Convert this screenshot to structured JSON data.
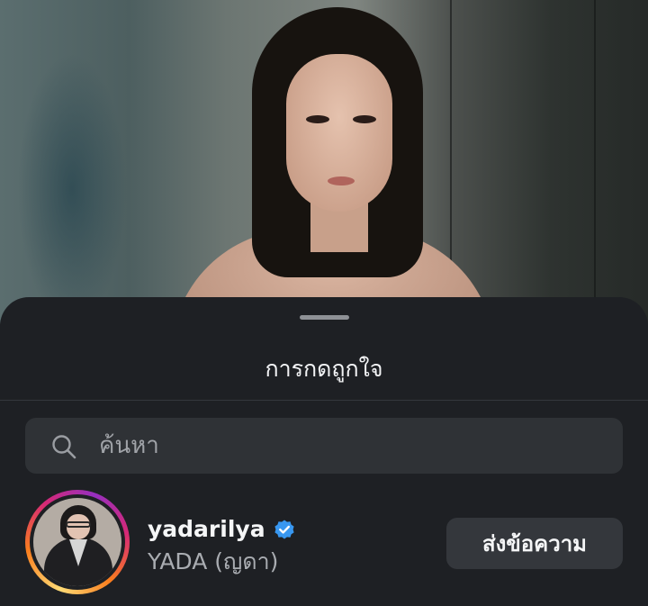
{
  "sheet": {
    "title": "การกดถูกใจ"
  },
  "search": {
    "icon": "search-icon",
    "placeholder": "ค้นหา",
    "value": ""
  },
  "likers": [
    {
      "username": "yadarilya",
      "verified": true,
      "verified_icon": "verified-badge-icon",
      "full_name": "YADA (ญดา)",
      "action_label": "ส่งข้อความ",
      "has_story_ring": true
    }
  ],
  "colors": {
    "sheet_background": "#1e2024",
    "search_background": "#2f3236",
    "button_background": "#34373c",
    "verified_blue": "#3897f0",
    "story_ring": [
      "#feda75",
      "#fa7e1e",
      "#d62976",
      "#962fbf"
    ]
  }
}
